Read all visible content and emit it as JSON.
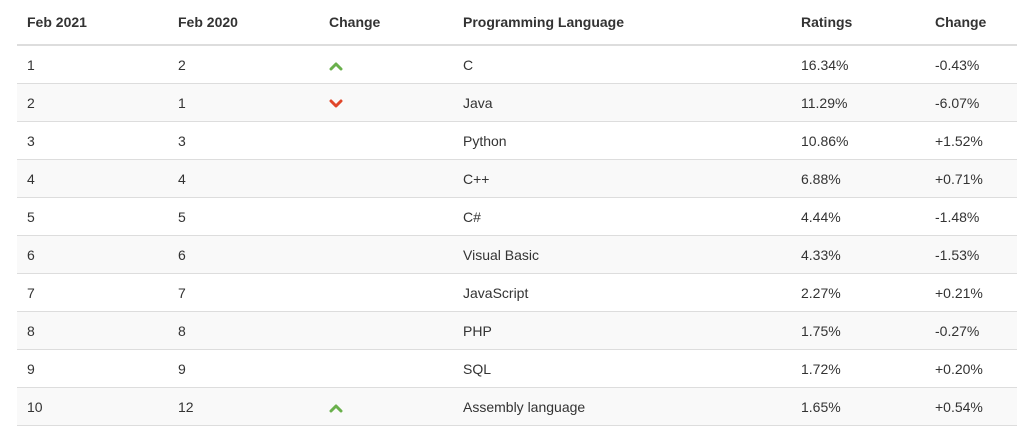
{
  "table": {
    "headers": [
      "Feb 2021",
      "Feb 2020",
      "Change",
      "Programming Language",
      "Ratings",
      "Change"
    ],
    "rows": [
      {
        "rank_2021": "1",
        "rank_2020": "2",
        "trend": "up",
        "trend_icon": "chevron-up-icon",
        "language": "C",
        "rating": "16.34%",
        "change": "-0.43%"
      },
      {
        "rank_2021": "2",
        "rank_2020": "1",
        "trend": "down",
        "trend_icon": "chevron-down-icon",
        "language": "Java",
        "rating": "11.29%",
        "change": "-6.07%"
      },
      {
        "rank_2021": "3",
        "rank_2020": "3",
        "trend": "none",
        "trend_icon": "",
        "language": "Python",
        "rating": "10.86%",
        "change": "+1.52%"
      },
      {
        "rank_2021": "4",
        "rank_2020": "4",
        "trend": "none",
        "trend_icon": "",
        "language": "C++",
        "rating": "6.88%",
        "change": "+0.71%"
      },
      {
        "rank_2021": "5",
        "rank_2020": "5",
        "trend": "none",
        "trend_icon": "",
        "language": "C#",
        "rating": "4.44%",
        "change": "-1.48%"
      },
      {
        "rank_2021": "6",
        "rank_2020": "6",
        "trend": "none",
        "trend_icon": "",
        "language": "Visual Basic",
        "rating": "4.33%",
        "change": "-1.53%"
      },
      {
        "rank_2021": "7",
        "rank_2020": "7",
        "trend": "none",
        "trend_icon": "",
        "language": "JavaScript",
        "rating": "2.27%",
        "change": "+0.21%"
      },
      {
        "rank_2021": "8",
        "rank_2020": "8",
        "trend": "none",
        "trend_icon": "",
        "language": "PHP",
        "rating": "1.75%",
        "change": "-0.27%"
      },
      {
        "rank_2021": "9",
        "rank_2020": "9",
        "trend": "none",
        "trend_icon": "",
        "language": "SQL",
        "rating": "1.72%",
        "change": "+0.20%"
      },
      {
        "rank_2021": "10",
        "rank_2020": "12",
        "trend": "up",
        "trend_icon": "chevron-up-icon",
        "language": "Assembly language",
        "rating": "1.65%",
        "change": "+0.54%"
      }
    ]
  },
  "colors": {
    "up": "#6ab04c",
    "down": "#e0462a",
    "row_alt": "#f9f9f9",
    "border": "#dddddd",
    "text": "#333333"
  }
}
